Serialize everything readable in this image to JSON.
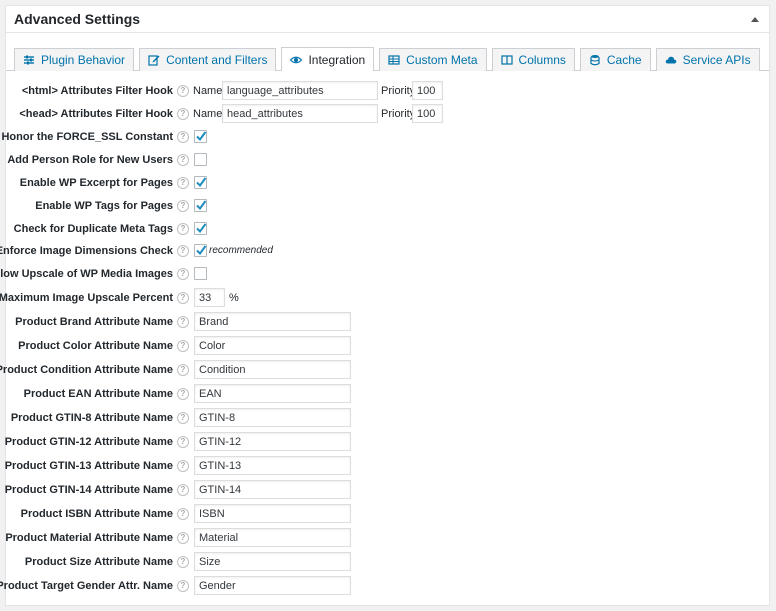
{
  "panel": {
    "title": "Advanced Settings"
  },
  "tabs": [
    {
      "label": "Plugin Behavior",
      "icon": "sliders-icon",
      "active": false
    },
    {
      "label": "Content and Filters",
      "icon": "edit-icon",
      "active": false
    },
    {
      "label": "Integration",
      "icon": "eye-icon",
      "active": true
    },
    {
      "label": "Custom Meta",
      "icon": "table-icon",
      "active": false
    },
    {
      "label": "Columns",
      "icon": "columns-icon",
      "active": false
    },
    {
      "label": "Cache",
      "icon": "database-icon",
      "active": false
    },
    {
      "label": "Service APIs",
      "icon": "cloud-icon",
      "active": false
    }
  ],
  "hooks": {
    "name_label": "Name:",
    "priority_label": "Priority:",
    "html": {
      "label": "<html> Attributes Filter Hook",
      "name": "language_attributes",
      "priority": "100"
    },
    "head": {
      "label": "<head> Attributes Filter Hook",
      "name": "head_attributes",
      "priority": "100"
    }
  },
  "options": {
    "force_ssl": {
      "label": "Honor the FORCE_SSL Constant",
      "checked": true
    },
    "person_role": {
      "label": "Add Person Role for New Users",
      "checked": false
    },
    "wp_excerpt": {
      "label": "Enable WP Excerpt for Pages",
      "checked": true
    },
    "wp_tags": {
      "label": "Enable WP Tags for Pages",
      "checked": true
    },
    "dup_meta": {
      "label": "Check for Duplicate Meta Tags",
      "checked": true
    },
    "img_dims": {
      "label": "Enforce Image Dimensions Check",
      "checked": true,
      "note": "recommended"
    },
    "upscale": {
      "label": "Allow Upscale of WP Media Images",
      "checked": false
    },
    "upscale_pct": {
      "label": "Maximum Image Upscale Percent",
      "value": "33",
      "unit": "%"
    }
  },
  "attributes": [
    {
      "label": "Product Brand Attribute Name",
      "value": "Brand"
    },
    {
      "label": "Product Color Attribute Name",
      "value": "Color"
    },
    {
      "label": "Product Condition Attribute Name",
      "value": "Condition"
    },
    {
      "label": "Product EAN Attribute Name",
      "value": "EAN"
    },
    {
      "label": "Product GTIN-8 Attribute Name",
      "value": "GTIN-8"
    },
    {
      "label": "Product GTIN-12 Attribute Name",
      "value": "GTIN-12"
    },
    {
      "label": "Product GTIN-13 Attribute Name",
      "value": "GTIN-13"
    },
    {
      "label": "Product GTIN-14 Attribute Name",
      "value": "GTIN-14"
    },
    {
      "label": "Product ISBN Attribute Name",
      "value": "ISBN"
    },
    {
      "label": "Product Material Attribute Name",
      "value": "Material"
    },
    {
      "label": "Product Size Attribute Name",
      "value": "Size"
    },
    {
      "label": "Product Target Gender Attr. Name",
      "value": "Gender"
    }
  ],
  "help_glyph": "?",
  "colors": {
    "link": "#0073aa",
    "check": "#1e8cbe"
  }
}
